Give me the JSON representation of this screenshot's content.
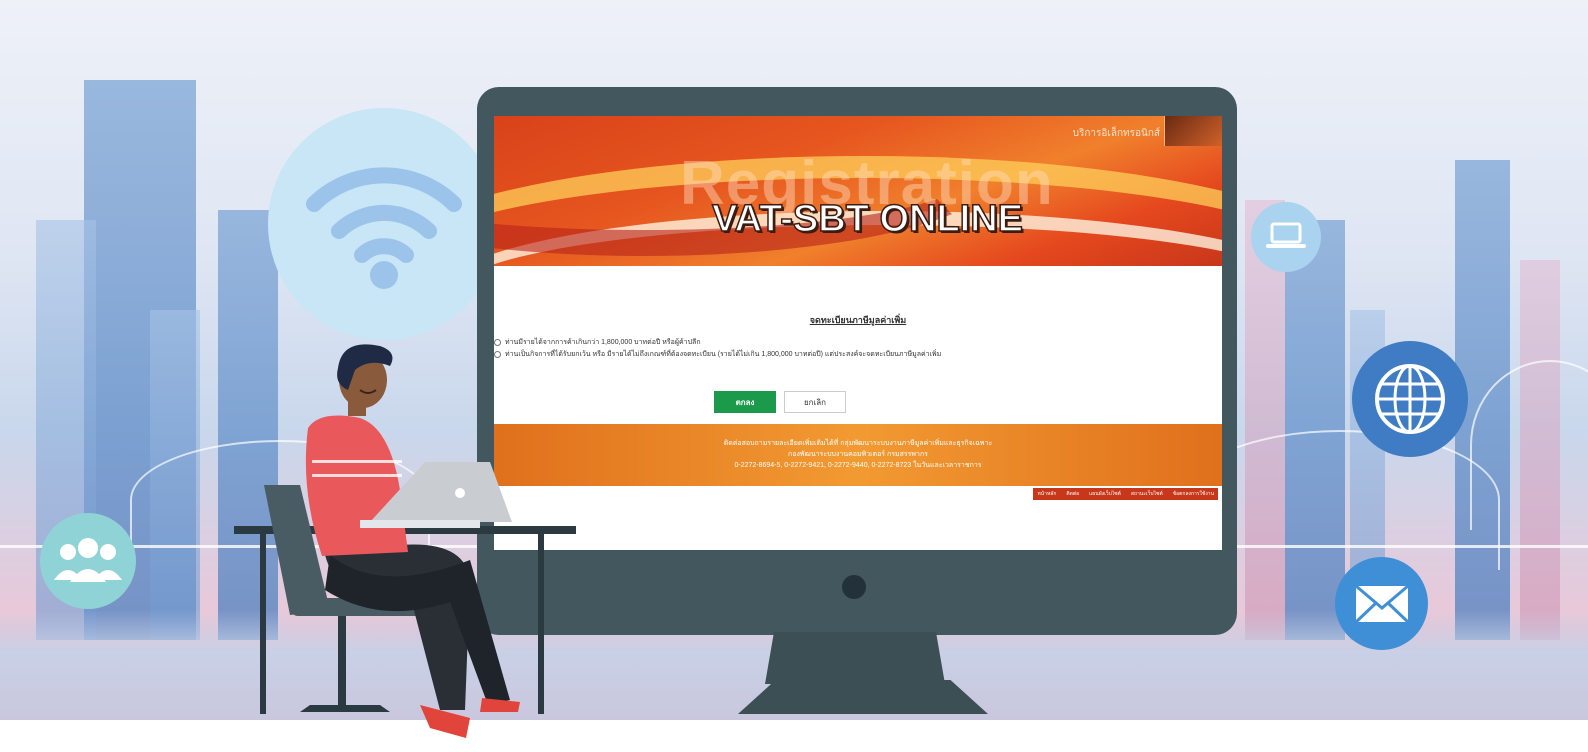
{
  "topbar": {
    "label": "บริการอิเล็กทรอนิกส์"
  },
  "hero": {
    "watermark": "Registration",
    "title": "VAT-SBT ONLINE"
  },
  "form": {
    "title": "จดทะเบียนภาษีมูลค่าเพิ่ม",
    "option_1": "ท่านมีรายได้จากการค้าเกินกว่า 1,800,000 บาทต่อปี หรือผู้ค้าปลีก",
    "option_2": "ท่านเป็นกิจการที่ได้รับยกเว้น หรือ มีรายได้ไม่ถึงเกณฑ์ที่ต้องจดทะเบียน (รายได้ไม่เกิน 1,800,000 บาทต่อปี) แต่ประสงค์จะจดทะเบียนภาษีมูลค่าเพิ่ม",
    "ok_label": "ตกลง",
    "cancel_label": "ยกเลิก"
  },
  "footer": {
    "line_1": "ติดต่อสอบถามรายละเอียดเพิ่มเติมได้ที่ กลุ่มพัฒนาระบบงานภาษีมูลค่าเพิ่มและธุรกิจเฉพาะ",
    "line_2": "กองพัฒนาระบบงานคอมพิวเตอร์ กรมสรรพากร",
    "line_3": "0-2272-8694-5, 0-2272-9421, 0-2272-9440, 0-2272-8723 ในวันและเวลาราชการ",
    "links": [
      "หน้าหลัก",
      "ติดต่อ",
      "แผนผังเว็บไซต์",
      "สถานะเว็บไซต์",
      "ข้อตกลงการใช้งาน"
    ]
  },
  "icons": [
    "wifi-icon",
    "laptop-icon",
    "globe-icon",
    "mail-icon",
    "users-icon"
  ],
  "colors": {
    "hero_orange": "#e6561f",
    "ok_green": "#1a9a4a",
    "monitor": "#43575e",
    "accent_blue": "#3f7cc3"
  }
}
